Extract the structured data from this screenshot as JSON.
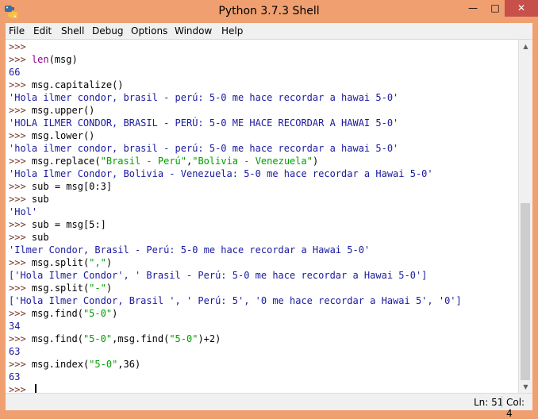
{
  "window": {
    "title": "Python 3.7.3 Shell"
  },
  "controls": {
    "minimize": "—",
    "maximize": "□",
    "close": "✕"
  },
  "menu": [
    "File",
    "Edit",
    "Shell",
    "Debug",
    "Options",
    "Window",
    "Help"
  ],
  "shell": {
    "prompt": ">>>",
    "lines": [
      {
        "kind": "in",
        "text": ""
      },
      {
        "kind": "in",
        "parts": [
          {
            "c": "fn",
            "t": "len"
          },
          {
            "c": "in",
            "t": "(msg)"
          }
        ]
      },
      {
        "kind": "out",
        "text": "66"
      },
      {
        "kind": "in",
        "parts": [
          {
            "c": "in",
            "t": "msg.capitalize()"
          }
        ]
      },
      {
        "kind": "out",
        "text": "'Hola ilmer condor, brasil - perú: 5-0 me hace recordar a hawai 5-0'"
      },
      {
        "kind": "in",
        "parts": [
          {
            "c": "in",
            "t": "msg.upper()"
          }
        ]
      },
      {
        "kind": "out",
        "text": "'HOLA ILMER CONDOR, BRASIL - PERÚ: 5-0 ME HACE RECORDAR A HAWAI 5-0'"
      },
      {
        "kind": "in",
        "parts": [
          {
            "c": "in",
            "t": "msg.lower()"
          }
        ]
      },
      {
        "kind": "out",
        "text": "'hola ilmer condor, brasil - perú: 5-0 me hace recordar a hawai 5-0'"
      },
      {
        "kind": "in",
        "parts": [
          {
            "c": "in",
            "t": "msg.replace("
          },
          {
            "c": "str",
            "t": "\"Brasil - Perú\""
          },
          {
            "c": "in",
            "t": ","
          },
          {
            "c": "str",
            "t": "\"Bolivia - Venezuela\""
          },
          {
            "c": "in",
            "t": ")"
          }
        ]
      },
      {
        "kind": "out",
        "text": "'Hola Ilmer Condor, Bolivia - Venezuela: 5-0 me hace recordar a Hawai 5-0'"
      },
      {
        "kind": "in",
        "parts": [
          {
            "c": "in",
            "t": "sub = msg[0:3]"
          }
        ]
      },
      {
        "kind": "in",
        "parts": [
          {
            "c": "in",
            "t": "sub"
          }
        ]
      },
      {
        "kind": "out",
        "text": "'Hol'"
      },
      {
        "kind": "in",
        "parts": [
          {
            "c": "in",
            "t": "sub = msg[5:]"
          }
        ]
      },
      {
        "kind": "in",
        "parts": [
          {
            "c": "in",
            "t": "sub"
          }
        ]
      },
      {
        "kind": "out",
        "text": "'Ilmer Condor, Brasil - Perú: 5-0 me hace recordar a Hawai 5-0'"
      },
      {
        "kind": "in",
        "parts": [
          {
            "c": "in",
            "t": "msg.split("
          },
          {
            "c": "str",
            "t": "\",\""
          },
          {
            "c": "in",
            "t": ")"
          }
        ]
      },
      {
        "kind": "out",
        "text": "['Hola Ilmer Condor', ' Brasil - Perú: 5-0 me hace recordar a Hawai 5-0']"
      },
      {
        "kind": "in",
        "parts": [
          {
            "c": "in",
            "t": "msg.split("
          },
          {
            "c": "str",
            "t": "\"-\""
          },
          {
            "c": "in",
            "t": ")"
          }
        ]
      },
      {
        "kind": "out",
        "text": "['Hola Ilmer Condor, Brasil ', ' Perú: 5', '0 me hace recordar a Hawai 5', '0']"
      },
      {
        "kind": "in",
        "parts": [
          {
            "c": "in",
            "t": "msg.find("
          },
          {
            "c": "str",
            "t": "\"5-0\""
          },
          {
            "c": "in",
            "t": ")"
          }
        ]
      },
      {
        "kind": "out",
        "text": "34"
      },
      {
        "kind": "in",
        "parts": [
          {
            "c": "in",
            "t": "msg.find("
          },
          {
            "c": "str",
            "t": "\"5-0\""
          },
          {
            "c": "in",
            "t": ",msg.find("
          },
          {
            "c": "str",
            "t": "\"5-0\""
          },
          {
            "c": "in",
            "t": ")+2)"
          }
        ]
      },
      {
        "kind": "out",
        "text": "63"
      },
      {
        "kind": "in",
        "parts": [
          {
            "c": "in",
            "t": "msg.index("
          },
          {
            "c": "str",
            "t": "\"5-0\""
          },
          {
            "c": "in",
            "t": ",36)"
          }
        ]
      },
      {
        "kind": "out",
        "text": "63"
      },
      {
        "kind": "cursor",
        "text": ""
      }
    ]
  },
  "status": {
    "line": "Ln: 51",
    "col": "Col: 4"
  },
  "colors": {
    "titlebar": "#f0a070",
    "close": "#c7504a",
    "prompt": "#7a3a2a",
    "output": "#1a1aa0",
    "builtin": "#900090",
    "string": "#00a000"
  },
  "icons": {
    "app": "python-logo-icon"
  }
}
